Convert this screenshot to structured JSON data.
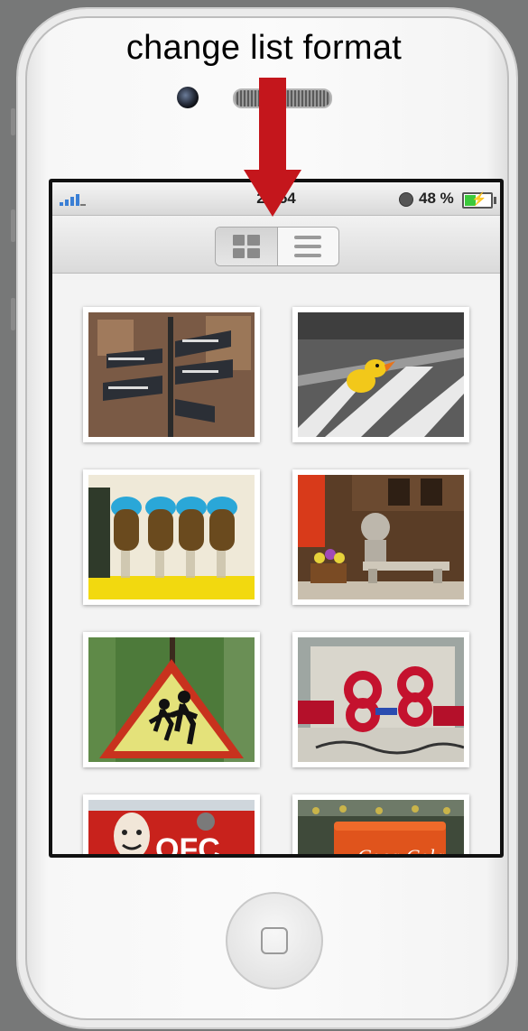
{
  "annotation": {
    "caption": "change list format",
    "arrow_color": "#c4161c"
  },
  "status_bar": {
    "time": "20:54",
    "battery_percent": "48 %",
    "battery_level": 0.48,
    "signal_bars": 4,
    "signal_icon": "signal-bars-icon",
    "alarm_icon": "clock-icon",
    "battery_icon": "battery-charging-icon"
  },
  "toolbar": {
    "segments": [
      {
        "icon": "grid-view-icon",
        "selected": true
      },
      {
        "icon": "list-view-icon",
        "selected": false
      }
    ]
  },
  "photos": [
    {
      "subject": "street-signs-photo"
    },
    {
      "subject": "duck-crosswalk-photo"
    },
    {
      "subject": "wall-payphones-photo"
    },
    {
      "subject": "statue-bench-photo"
    },
    {
      "subject": "children-crossing-sign-photo"
    },
    {
      "subject": "wreath-memorial-photo"
    },
    {
      "subject": "red-billboard-photo",
      "text": "OFC"
    },
    {
      "subject": "coca-cola-cooler-photo",
      "text": "Coca-Cola"
    }
  ],
  "device": {
    "home_button_icon": "home-button-icon"
  }
}
